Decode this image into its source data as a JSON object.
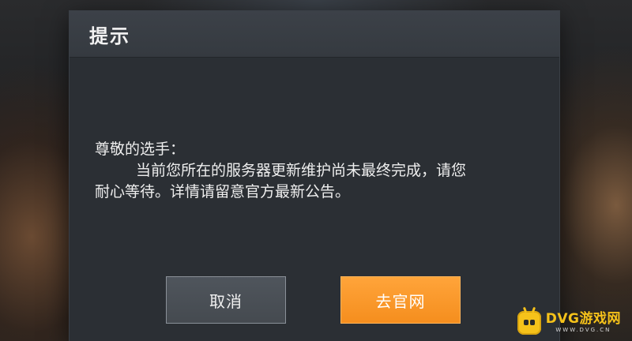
{
  "dialog": {
    "title": "提示",
    "message": {
      "greeting": "尊敬的选手：",
      "line1": "当前您所在的服务器更新维护尚未最终完成，请您",
      "line2": "耐心等待。详情请留意官方最新公告。"
    },
    "buttons": {
      "cancel_label": "取消",
      "official_site_label": "去官网"
    }
  },
  "watermark": {
    "name": "DVG游戏网",
    "url": "WWW.DVG.CN"
  },
  "colors": {
    "dialog_bg": "#2b2f34",
    "accent_orange": "#f58e1e",
    "watermark_yellow": "#f6c21a"
  }
}
